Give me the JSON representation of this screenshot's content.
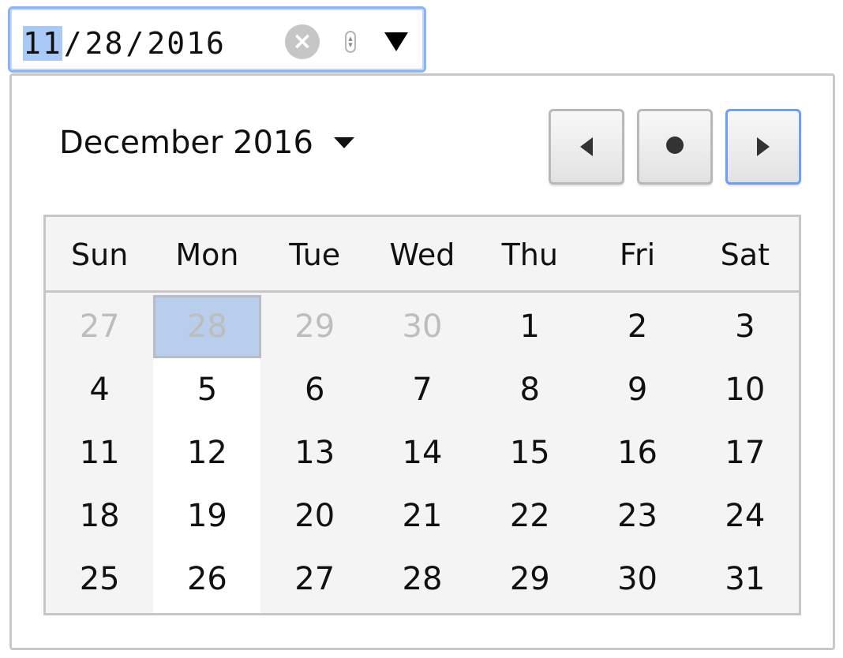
{
  "date_input": {
    "month": "11",
    "day": "28",
    "year": "2016",
    "separator": "/",
    "clear_glyph": "×",
    "spin_up_glyph": "▲",
    "spin_down_glyph": "▼",
    "icons": {
      "clear": "clear-circle-icon",
      "spin": "spin-arrows-icon",
      "dropdown": "dropdown-triangle-icon"
    }
  },
  "calendar": {
    "month_label": "December 2016",
    "nav": {
      "prev": "left-triangle-icon",
      "today": "dot-icon",
      "next": "right-triangle-icon"
    },
    "weekdays": [
      "Sun",
      "Mon",
      "Tue",
      "Wed",
      "Thu",
      "Fri",
      "Sat"
    ],
    "weeks": [
      [
        {
          "d": "27",
          "muted": true
        },
        {
          "d": "28",
          "muted": true,
          "selected": true
        },
        {
          "d": "29",
          "muted": true
        },
        {
          "d": "30",
          "muted": true
        },
        {
          "d": "1"
        },
        {
          "d": "2"
        },
        {
          "d": "3"
        }
      ],
      [
        {
          "d": "4"
        },
        {
          "d": "5"
        },
        {
          "d": "6"
        },
        {
          "d": "7"
        },
        {
          "d": "8"
        },
        {
          "d": "9"
        },
        {
          "d": "10"
        }
      ],
      [
        {
          "d": "11"
        },
        {
          "d": "12"
        },
        {
          "d": "13"
        },
        {
          "d": "14"
        },
        {
          "d": "15"
        },
        {
          "d": "16"
        },
        {
          "d": "17"
        }
      ],
      [
        {
          "d": "18"
        },
        {
          "d": "19"
        },
        {
          "d": "20"
        },
        {
          "d": "21"
        },
        {
          "d": "22"
        },
        {
          "d": "23"
        },
        {
          "d": "24"
        }
      ],
      [
        {
          "d": "25"
        },
        {
          "d": "26"
        },
        {
          "d": "27"
        },
        {
          "d": "28"
        },
        {
          "d": "29"
        },
        {
          "d": "30"
        },
        {
          "d": "31"
        }
      ]
    ]
  },
  "colors": {
    "focus_ring": "#8ab4f8",
    "selected_day": "#b9cdec",
    "muted_text": "#bdbdbd",
    "grid_bg": "#f4f4f4"
  }
}
